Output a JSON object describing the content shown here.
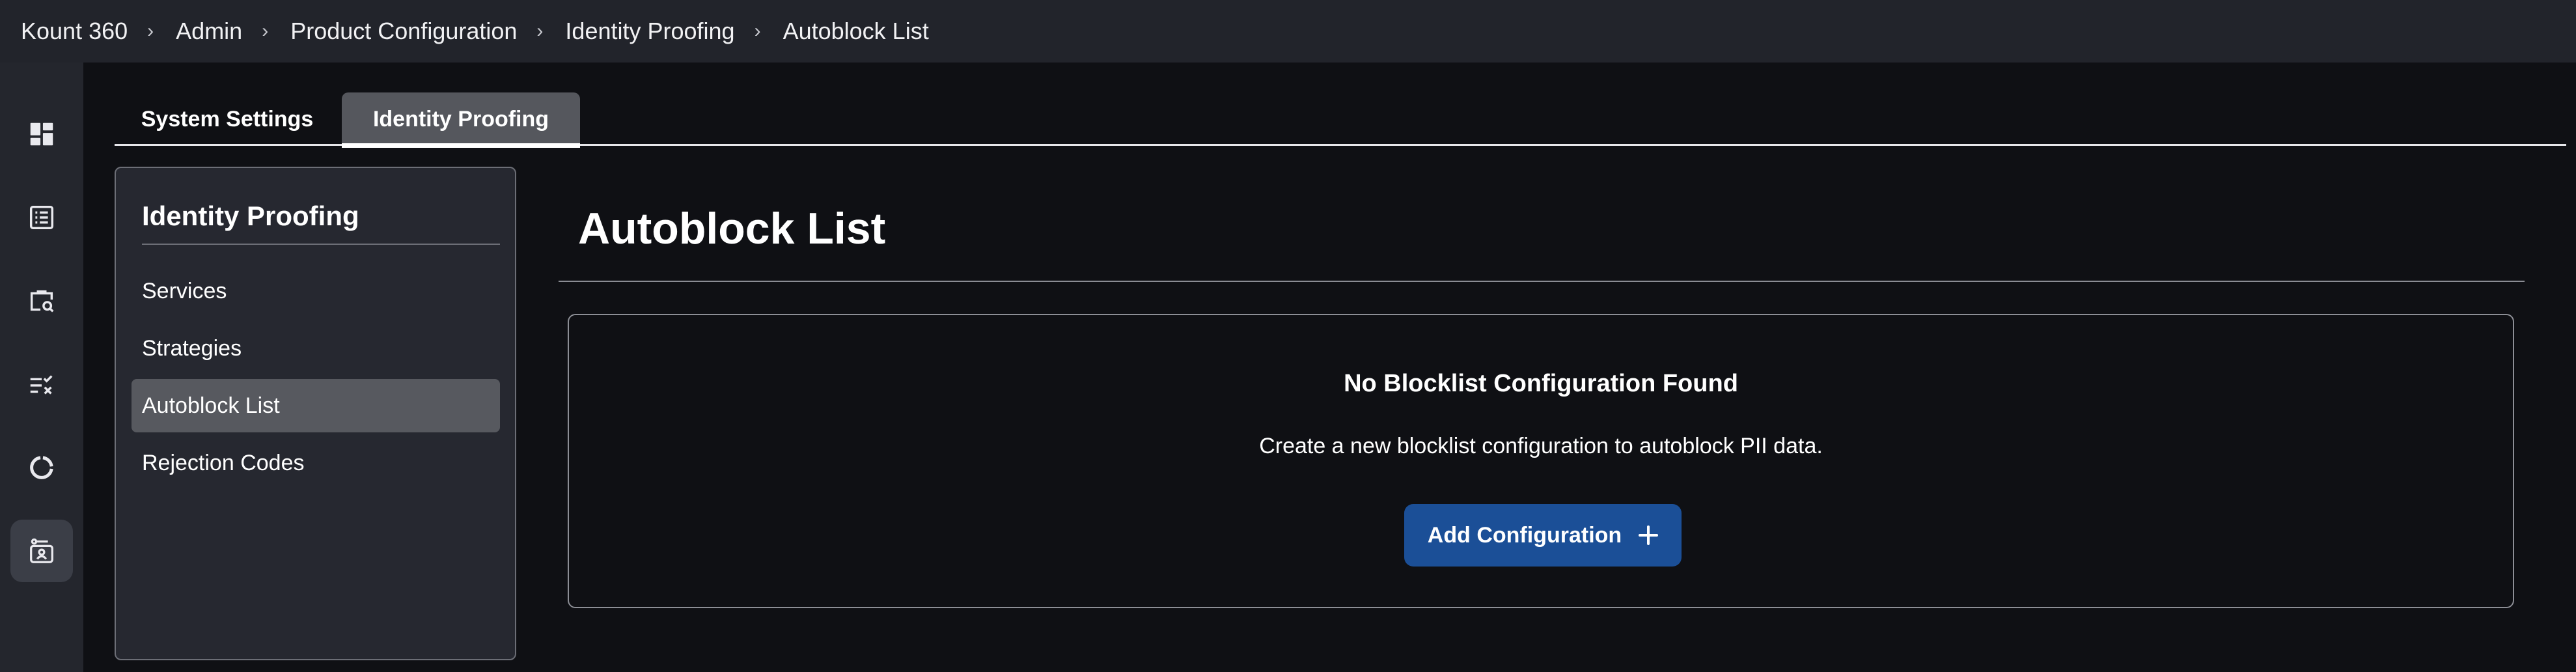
{
  "breadcrumb": {
    "items": [
      "Kount 360",
      "Admin",
      "Product Configuration",
      "Identity Proofing",
      "Autoblock List"
    ],
    "separator": "›"
  },
  "rail": {
    "icons": [
      "dashboard-icon",
      "list-icon",
      "briefcase-search-icon",
      "rules-icon",
      "progress-ring-icon",
      "identity-proofing-icon"
    ],
    "active_index": 5
  },
  "tabs": [
    {
      "label": "System Settings",
      "active": false
    },
    {
      "label": "Identity Proofing",
      "active": true
    }
  ],
  "sidepanel": {
    "title": "Identity Proofing",
    "items": [
      {
        "label": "Services",
        "active": false
      },
      {
        "label": "Strategies",
        "active": false
      },
      {
        "label": "Autoblock List",
        "active": true
      },
      {
        "label": "Rejection Codes",
        "active": false
      }
    ]
  },
  "main": {
    "title": "Autoblock List",
    "empty_state": {
      "title": "No Blocklist Configuration Found",
      "description": "Create a new blocklist configuration to autoblock PII data.",
      "button_label": "Add Configuration"
    }
  },
  "colors": {
    "topbar_bg": "#22242b",
    "rail_bg": "#24262d",
    "page_bg": "#0f1014",
    "panel_bg": "#262830",
    "active_item_bg": "#57595f",
    "primary_button": "#1b4f97"
  }
}
